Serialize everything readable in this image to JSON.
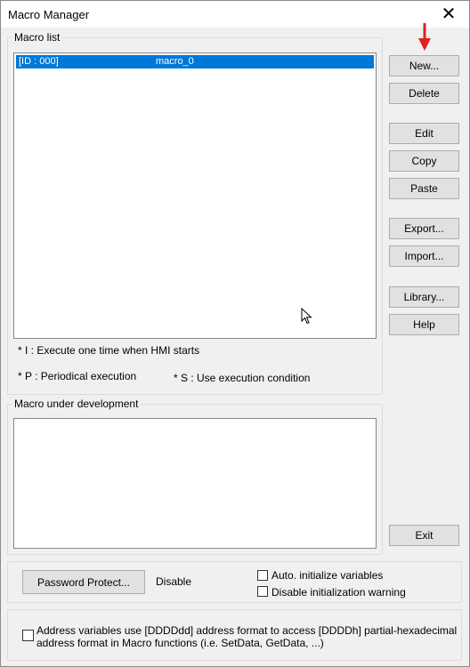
{
  "window": {
    "title": "Macro Manager",
    "close_symbol": "✕"
  },
  "macro_list": {
    "legend": "Macro list",
    "items": [
      {
        "id": "[ID : 000]",
        "name": "macro_0",
        "selected": true
      }
    ],
    "notes": {
      "i": "* I : Execute one time when HMI starts",
      "p": "* P : Periodical execution",
      "s": "* S : Use execution condition"
    }
  },
  "buttons": {
    "new": "New...",
    "delete": "Delete",
    "edit": "Edit",
    "copy": "Copy",
    "paste": "Paste",
    "export": "Export...",
    "import": "Import...",
    "library": "Library...",
    "help": "Help",
    "exit": "Exit",
    "password_protect": "Password Protect..."
  },
  "development": {
    "legend": "Macro under development"
  },
  "protection": {
    "status": "Disable",
    "auto_init_label": "Auto. initialize variables",
    "auto_init_checked": false,
    "disable_warning_label": "Disable initialization warning",
    "disable_warning_checked": false
  },
  "address_format": {
    "label_line1": "Address variables use [DDDDdd] address format to access [DDDDh] partial-hexadecimal",
    "label_line2": "address format in Macro functions (i.e. SetData, GetData, ...)",
    "checked": false
  },
  "annotation": {
    "arrow_color": "#e02020"
  },
  "colors": {
    "selection": "#0078d7"
  }
}
